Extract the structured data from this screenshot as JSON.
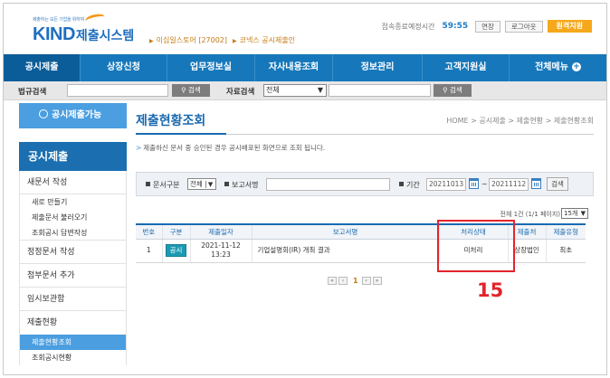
{
  "header": {
    "logo_tagline": "제출하는 모든 기업을 위하여",
    "logo_kind": "KIND",
    "logo_system": "제출시스템",
    "company_link": "이십일스토어 [27002]",
    "market_link": "코넥스 공시제출인",
    "session_label": "접속종료예정시간",
    "session_time": "59:55",
    "extend_button": "연장",
    "logout_button": "로그아웃",
    "remote_button": "원격지원"
  },
  "nav": {
    "items": [
      "공시제출",
      "상장신청",
      "업무정보실",
      "자사내용조회",
      "정보관리",
      "고객지원실",
      "전체메뉴"
    ]
  },
  "searchbar": {
    "law_label": "법규검색",
    "law_button": "검색",
    "material_label": "자료검색",
    "material_select": "전체",
    "material_button": "검색"
  },
  "sidebar": {
    "deadline_button": "공시제출가능",
    "section_title": "공시제출",
    "items": [
      {
        "label": "새문서 작성",
        "type": "main"
      },
      {
        "label": "새로 만들기",
        "type": "sub"
      },
      {
        "label": "제출문서 불러오기",
        "type": "sub"
      },
      {
        "label": "조회공시 답변작성",
        "type": "sub"
      },
      {
        "label": "정정문서 작성",
        "type": "main"
      },
      {
        "label": "첨부문서 추가",
        "type": "main"
      },
      {
        "label": "임시보관함",
        "type": "main"
      },
      {
        "label": "제출현황",
        "type": "main"
      },
      {
        "label": "제출현황조회",
        "type": "sub"
      },
      {
        "label": "조회공시현황",
        "type": "sub"
      }
    ]
  },
  "content": {
    "page_title": "제출현황조회",
    "breadcrumb": "HOME > 공시제출 > 제출현황 > 제출현황조회",
    "notice": "제출하신 문서 중 승인된 경우 공시배포된 화면으로 조회 됩니다.",
    "filter": {
      "doc_type_label": "문서구분",
      "doc_type_value": "전체",
      "report_name_label": "보고서명",
      "period_label": "기간",
      "date_from": "20211013",
      "date_to": "20211112",
      "search_button": "검색"
    },
    "count_text": "전체 1건 (1/1 페이지)",
    "per_page": "15개",
    "table": {
      "headers": [
        "번호",
        "구분",
        "제출일자",
        "보고서명",
        "처리상태",
        "제출처",
        "제출유형"
      ],
      "rows": [
        {
          "no": "1",
          "kind": "공시",
          "date": "2021-11-12",
          "time": "13:23",
          "report": "기업설명회(IR) 개최 결과",
          "status": "미처리",
          "dest": "상장법인",
          "type": "최초"
        }
      ]
    },
    "pager": {
      "current": "1"
    },
    "annotation_number": "15"
  },
  "colors": {
    "brand_blue": "#1678bb",
    "accent_orange": "#f5a81c",
    "annotation_red": "#e3242b"
  }
}
